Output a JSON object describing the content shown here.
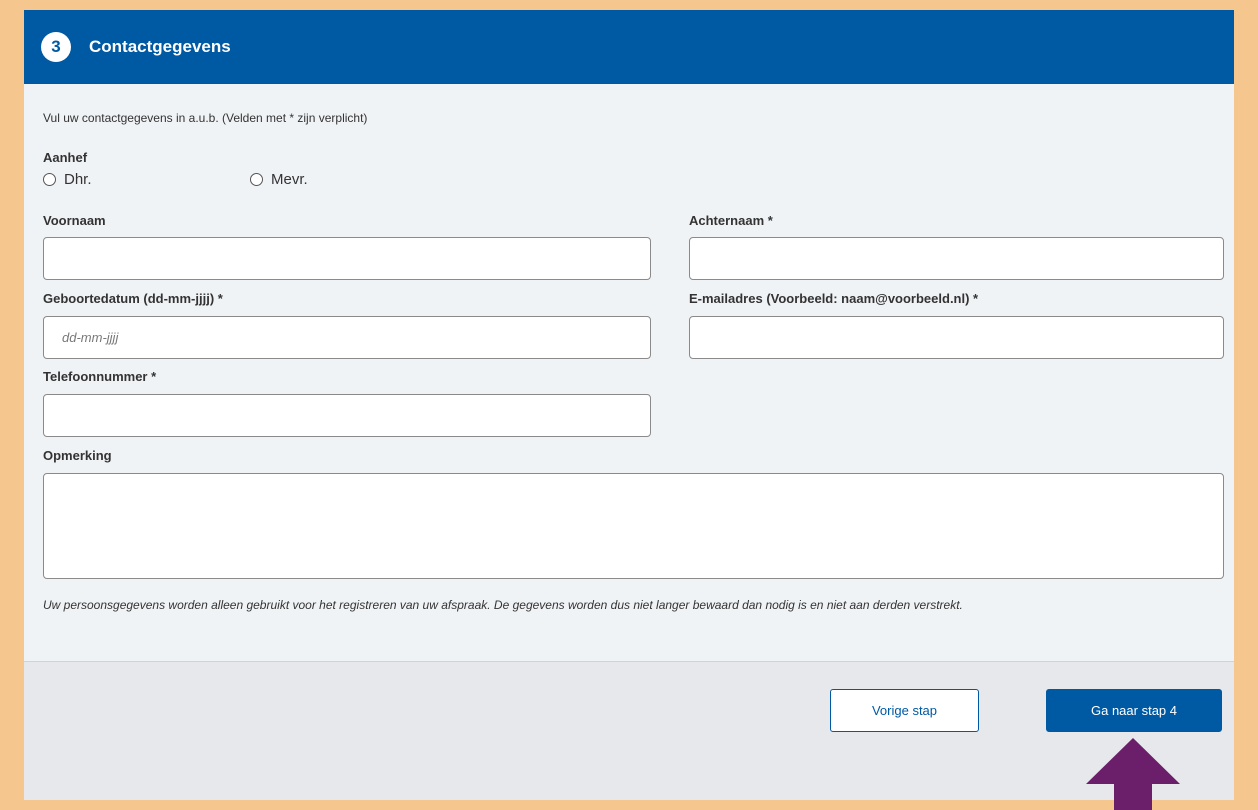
{
  "header": {
    "step_number": "3",
    "title": "Contactgegevens"
  },
  "intro": "Vul uw contactgegevens in a.u.b. (Velden met * zijn verplicht)",
  "salutation": {
    "label": "Aanhef",
    "options": [
      "Dhr.",
      "Mevr."
    ]
  },
  "fields": {
    "first_name": {
      "label": "Voornaam",
      "value": "",
      "placeholder": ""
    },
    "last_name": {
      "label": "Achternaam *",
      "value": "",
      "placeholder": ""
    },
    "birthdate": {
      "label": "Geboortedatum (dd-mm-jjjj) *",
      "value": "",
      "placeholder": "dd-mm-jjjj"
    },
    "email": {
      "label": "E-mailadres (Voorbeeld: naam@voorbeeld.nl) *",
      "value": "",
      "placeholder": ""
    },
    "phone": {
      "label": "Telefoonnummer *",
      "value": "",
      "placeholder": ""
    },
    "remark": {
      "label": "Opmerking",
      "value": ""
    }
  },
  "privacy_note": "Uw persoonsgegevens worden alleen gebruikt voor het registreren van uw afspraak. De gegevens worden dus niet langer bewaard dan nodig is en niet aan derden verstrekt.",
  "buttons": {
    "prev": "Vorige stap",
    "next": "Ga naar stap 4"
  },
  "colors": {
    "brand": "#0059a3",
    "page_background": "#f5c78e",
    "arrow": "#6b1f6b"
  }
}
